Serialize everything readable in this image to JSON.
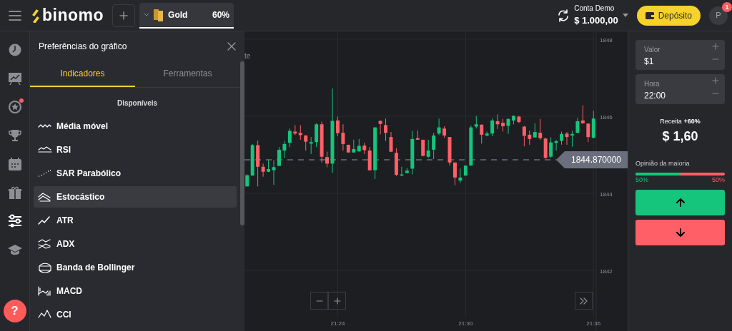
{
  "header": {
    "logo": "binomo",
    "asset": {
      "name": "Gold",
      "payout": "60%",
      "selected": true
    },
    "account": {
      "label": "Conta Demo",
      "balance": "$ 1.000,00"
    },
    "deposit": "Depósito",
    "avatar": "P",
    "badge": "1"
  },
  "sidebar": {
    "items": [
      {
        "selected": false,
        "dot": false
      },
      {
        "selected": false,
        "dot": false
      },
      {
        "selected": false,
        "dot": true
      },
      {
        "selected": false,
        "dot": false
      },
      {
        "selected": false,
        "dot": false
      },
      {
        "selected": false,
        "dot": false
      },
      {
        "selected": true,
        "dot": false
      },
      {
        "selected": false,
        "dot": false
      }
    ],
    "help": "?"
  },
  "panel": {
    "title": "Preferências do gráfico",
    "tabs": [
      {
        "label": "Indicadores",
        "selected": true
      },
      {
        "label": "Ferramentas",
        "selected": false
      }
    ],
    "section": "Disponíveis",
    "indicators": [
      {
        "label": "Média móvel",
        "selected": false
      },
      {
        "label": "RSI",
        "selected": false
      },
      {
        "label": "SAR Parabólico",
        "selected": false
      },
      {
        "label": "Estocástico",
        "selected": true
      },
      {
        "label": "ATR",
        "selected": false
      },
      {
        "label": "ADX",
        "selected": false
      },
      {
        "label": "Banda de Bollinger",
        "selected": false
      },
      {
        "label": "MACD",
        "selected": false
      },
      {
        "label": "CCI",
        "selected": false
      }
    ]
  },
  "chart": {
    "partial_label": "te",
    "chart_data": {
      "type": "candlestick",
      "ylim": [
        1840.8,
        1848.2
      ],
      "grid": true,
      "ref_lines": [
        {
          "axis": "y",
          "value": 1844.87,
          "label": "1844.870000"
        }
      ],
      "yticks": [
        1842,
        1844,
        1846,
        1848
      ],
      "categories": [
        null,
        null,
        null,
        null,
        null,
        null,
        null,
        null,
        null,
        null,
        null,
        null,
        null,
        null,
        null,
        null,
        null,
        "21:24",
        null,
        null,
        null,
        null,
        null,
        null,
        null,
        null,
        null,
        null,
        null,
        null,
        null,
        null,
        null,
        null,
        null,
        null,
        null,
        null,
        null,
        null,
        null,
        "21:30",
        null,
        null,
        null,
        null,
        null,
        null,
        null,
        null,
        null,
        null,
        null,
        null,
        null,
        null,
        null,
        null,
        null,
        null,
        null,
        null,
        null,
        null,
        null,
        "21:36"
      ],
      "ohlc": [
        [
          1844.18,
          1844.49,
          1844.18,
          1844.47
        ],
        [
          1844.46,
          1845.28,
          1844.46,
          1845.25
        ],
        [
          1845.25,
          1845.37,
          1844.18,
          1844.69
        ],
        [
          1844.69,
          1844.77,
          1844.43,
          1844.56
        ],
        [
          1844.56,
          1844.86,
          1844.55,
          1844.63
        ],
        [
          1844.6,
          1844.86,
          1844.22,
          1844.68
        ],
        [
          1844.71,
          1845.2,
          1844.71,
          1845.13
        ],
        [
          1845.11,
          1845.36,
          1844.92,
          1845.28
        ],
        [
          1845.31,
          1845.68,
          1845.2,
          1845.62
        ],
        [
          1845.6,
          1845.77,
          1845.51,
          1845.55
        ],
        [
          1845.57,
          1845.77,
          1845.39,
          1845.51
        ],
        [
          1845.5,
          1845.51,
          1845.11,
          1845.34
        ],
        [
          1845.29,
          1845.46,
          1845.02,
          1845.33
        ],
        [
          1845.33,
          1845.82,
          1845.2,
          1845.79
        ],
        [
          1845.79,
          1845.86,
          1844.8,
          1844.95
        ],
        [
          1844.94,
          1845.08,
          1844.68,
          1844.77
        ],
        [
          1844.77,
          1846.72,
          1844.53,
          1845.88
        ],
        [
          1845.89,
          1845.99,
          1845.48,
          1845.56
        ],
        [
          1845.57,
          1845.79,
          1845.11,
          1845.28
        ],
        [
          1845.26,
          1845.26,
          1845.06,
          1845.06
        ],
        [
          1845.06,
          1845.39,
          1845.05,
          1845.15
        ],
        [
          1845.09,
          1845.41,
          1845.07,
          1845.23
        ],
        [
          1845.24,
          1845.31,
          1845.02,
          1845.12
        ],
        [
          1845.11,
          1845.2,
          1844.58,
          1844.6
        ],
        [
          1844.6,
          1845.71,
          1844.37,
          1845.71
        ],
        [
          1845.88,
          1845.89,
          1845.53,
          1845.8
        ],
        [
          1845.77,
          1845.94,
          1845.36,
          1845.57
        ],
        [
          1845.46,
          1845.59,
          1845.07,
          1845.08
        ],
        [
          1845.05,
          1845.17,
          1844.45,
          1844.48
        ],
        [
          1844.46,
          1844.69,
          1844.45,
          1844.49
        ],
        [
          1844.53,
          1844.66,
          1844.51,
          1844.59
        ],
        [
          1844.64,
          1845.62,
          1844.49,
          1845.41
        ],
        [
          1845.43,
          1845.63,
          1845.39,
          1845.39
        ],
        [
          1845.39,
          1845.39,
          1844.97,
          1844.97
        ],
        [
          1844.95,
          1845.39,
          1844.92,
          1845.11
        ],
        [
          1845.13,
          1845.57,
          1844.89,
          1845.5
        ],
        [
          1845.55,
          1845.94,
          1845.51,
          1845.71
        ],
        [
          1845.68,
          1845.74,
          1845.44,
          1845.5
        ],
        [
          1845.46,
          1845.46,
          1844.72,
          1844.8
        ],
        [
          1844.8,
          1844.8,
          1844.21,
          1844.41
        ],
        [
          1844.33,
          1844.64,
          1844.27,
          1844.41
        ],
        [
          1844.46,
          1844.72,
          1844.46,
          1844.72
        ],
        [
          1844.72,
          1845.76,
          1844.72,
          1845.71
        ],
        [
          1845.73,
          1846.01,
          1845.68,
          1845.79
        ],
        [
          1845.78,
          1845.79,
          1845.29,
          1845.52
        ],
        [
          1845.5,
          1845.6,
          1845.48,
          1845.55
        ],
        [
          1845.55,
          1845.94,
          1845.48,
          1845.89
        ],
        [
          1845.87,
          1846.05,
          1845.67,
          1845.79
        ],
        [
          1845.83,
          1845.93,
          1845.6,
          1845.74
        ],
        [
          1845.75,
          1845.94,
          1845.54,
          1845.93
        ],
        [
          1845.89,
          1846.02,
          1845.79,
          1846.01
        ],
        [
          1845.99,
          1846.01,
          1845.82,
          1845.85
        ],
        [
          1845.73,
          1845.75,
          1845.22,
          1845.49
        ],
        [
          1845.52,
          1845.63,
          1845.26,
          1845.41
        ],
        [
          1845.45,
          1845.82,
          1845.44,
          1845.59
        ],
        [
          1845.57,
          1845.93,
          1845.39,
          1845.43
        ],
        [
          1845.42,
          1845.44,
          1844.9,
          1844.92
        ],
        [
          1844.95,
          1845.45,
          1844.92,
          1845.32
        ],
        [
          1845.31,
          1845.39,
          1845.11,
          1845.35
        ],
        [
          1845.36,
          1845.6,
          1845.26,
          1845.54
        ],
        [
          1845.55,
          1845.59,
          1845.26,
          1845.46
        ],
        [
          1845.5,
          1845.62,
          1845.21,
          1845.54
        ],
        [
          1845.57,
          1845.96,
          1845.56,
          1845.87
        ],
        [
          1845.89,
          1846.28,
          1845.8,
          1845.82
        ],
        [
          1845.81,
          1845.81,
          1845.33,
          1845.46
        ],
        [
          1845.44,
          1846.14,
          1845.43,
          1845.94
        ]
      ]
    }
  },
  "trade": {
    "amount": {
      "label": "Valor",
      "value": "$1"
    },
    "time": {
      "label": "Hora",
      "value": "22:00"
    },
    "payout": {
      "label": "Receita",
      "bonus": "+60%",
      "value": "$ 1,60"
    },
    "opinion": {
      "label": "Opinião da maioria",
      "level": 0.5,
      "up": "50%",
      "down": "50%"
    }
  }
}
